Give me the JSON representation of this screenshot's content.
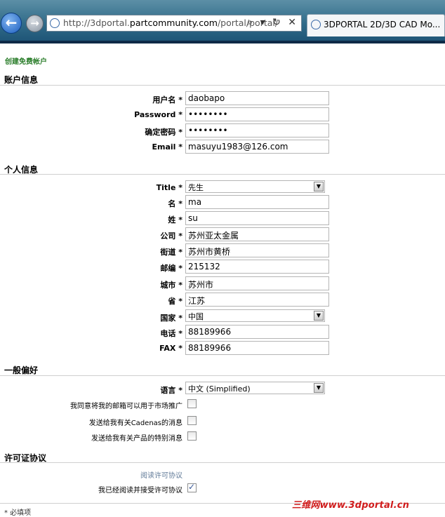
{
  "browser": {
    "url_prefix": "http://3dportal.",
    "url_domain": "partcommunity.com",
    "url_path": "/portal/portal/",
    "address_buttons": "⌕ ▾ ↻ ✕",
    "tab_title": "3DPORTAL 2D/3D CAD Mo..."
  },
  "page": {
    "title": "创建免费帐户"
  },
  "sections": {
    "account": "账户信息",
    "personal": "个人信息",
    "general": "一般偏好",
    "license": "许可证协议"
  },
  "account": {
    "username": {
      "label": "用户名 *",
      "value": "daobapo"
    },
    "password": {
      "label": "Password *",
      "value": "••••••••"
    },
    "confirm": {
      "label": "确定密码 *",
      "value": "••••••••"
    },
    "email": {
      "label": "Email *",
      "value": "masuyu1983@126.com"
    }
  },
  "personal": {
    "title": {
      "label": "Title *",
      "value": "先生"
    },
    "first_name": {
      "label": "名 *",
      "value": "ma"
    },
    "last_name": {
      "label": "姓 *",
      "value": "su"
    },
    "company": {
      "label": "公司 *",
      "value": "苏州亚太金属"
    },
    "street": {
      "label": "街道 *",
      "value": "苏州市黄桥"
    },
    "zip": {
      "label": "邮编 *",
      "value": "215132"
    },
    "city": {
      "label": "城市 *",
      "value": "苏州市"
    },
    "province": {
      "label": "省 *",
      "value": "江苏"
    },
    "country": {
      "label": "国家 *",
      "value": "中国"
    },
    "phone": {
      "label": "电话 *",
      "value": "88189966"
    },
    "fax": {
      "label": "FAX *",
      "value": "88189966"
    }
  },
  "general": {
    "language": {
      "label": "语言 *",
      "value": "中文 (Simplified)"
    },
    "marketing_opt": {
      "label": "我同意将我的邮箱可以用于市场推广",
      "checked": false
    },
    "cadenas_news": {
      "label": "发送给我有关Cadenas的消息",
      "checked": false
    },
    "product_offers": {
      "label": "发送给我有关产品的特别消息",
      "checked": false
    }
  },
  "license": {
    "read_link": "阅读许可协议",
    "accept": {
      "label": "我已经阅读并接受许可协议",
      "checked": true
    }
  },
  "footer": {
    "watermark": "三维网www.3dportal.cn",
    "note": "* 必填项"
  }
}
